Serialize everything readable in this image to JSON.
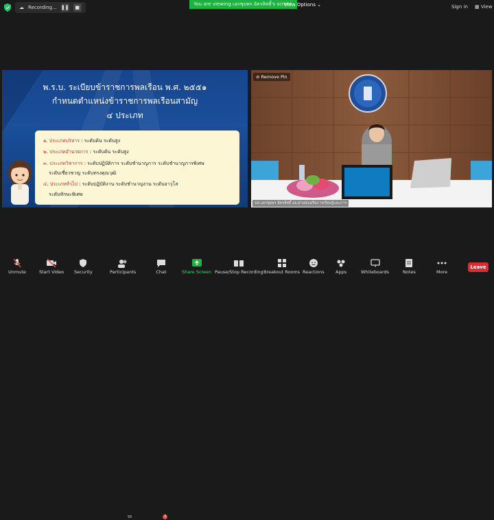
{
  "topbar": {
    "recording_label": "Recording...",
    "viewing_banner": "You are viewing เอกชุมพร อัครลิทธิ์'s screen",
    "view_options": "View Options",
    "sign_in": "Sign in",
    "view": "View"
  },
  "slide": {
    "title_line1": "พ.ร.บ. ระเบียบข้าราชการพลเรือน พ.ศ. ๒๕๕๑",
    "title_line2": "กำหนดตำแหน่งข้าราชการพลเรือนสามัญ",
    "title_line3": "๔ ประเภท",
    "items": [
      {
        "num": "๑.",
        "label": "ประเภทบริหาร",
        "text": " : ระดับต้น ระดับสูง"
      },
      {
        "num": "๒.",
        "label": "ประเภทอำนวยการ",
        "text": " : ระดับต้น ระดับสูง"
      },
      {
        "num": "๓.",
        "label": "ประเภทวิชาการ",
        "text": " : ระดับปฏิบัติการ ระดับชำนาญการ ระดับชำนาญการพิเศษ"
      },
      {
        "num": "",
        "label": "",
        "text": "ระดับเชี่ยวชาญ ระดับทรงคุณวุฒิ"
      },
      {
        "num": "๔.",
        "label": "ประเภททั่วไป",
        "text": " : ระดับปฏิบัติงาน ระดับชำนาญงาน ระดับอาวุโส"
      },
      {
        "num": "",
        "label": "",
        "text": "ระดับทักษะพิเศษ"
      }
    ]
  },
  "video": {
    "remove_pin": "Remove Pin",
    "caption": "นส.เอกชุมพร อัครลิทธิ์ ผอ.ฝ่ายส่งเสริมการเรียนรู้และการ"
  },
  "toolbar": {
    "items": [
      {
        "label": "Unmute"
      },
      {
        "label": "Start Video"
      },
      {
        "label": "Security"
      },
      {
        "label": "Participants",
        "count": "55"
      },
      {
        "label": "Chat",
        "badge": "3"
      },
      {
        "label": "Share Screen"
      },
      {
        "label": "Pause/Stop Recording"
      },
      {
        "label": "Breakout Rooms"
      },
      {
        "label": "Reactions"
      },
      {
        "label": "Apps"
      },
      {
        "label": "Whiteboards"
      },
      {
        "label": "Notes"
      },
      {
        "label": "More"
      }
    ],
    "leave": "Leave"
  }
}
